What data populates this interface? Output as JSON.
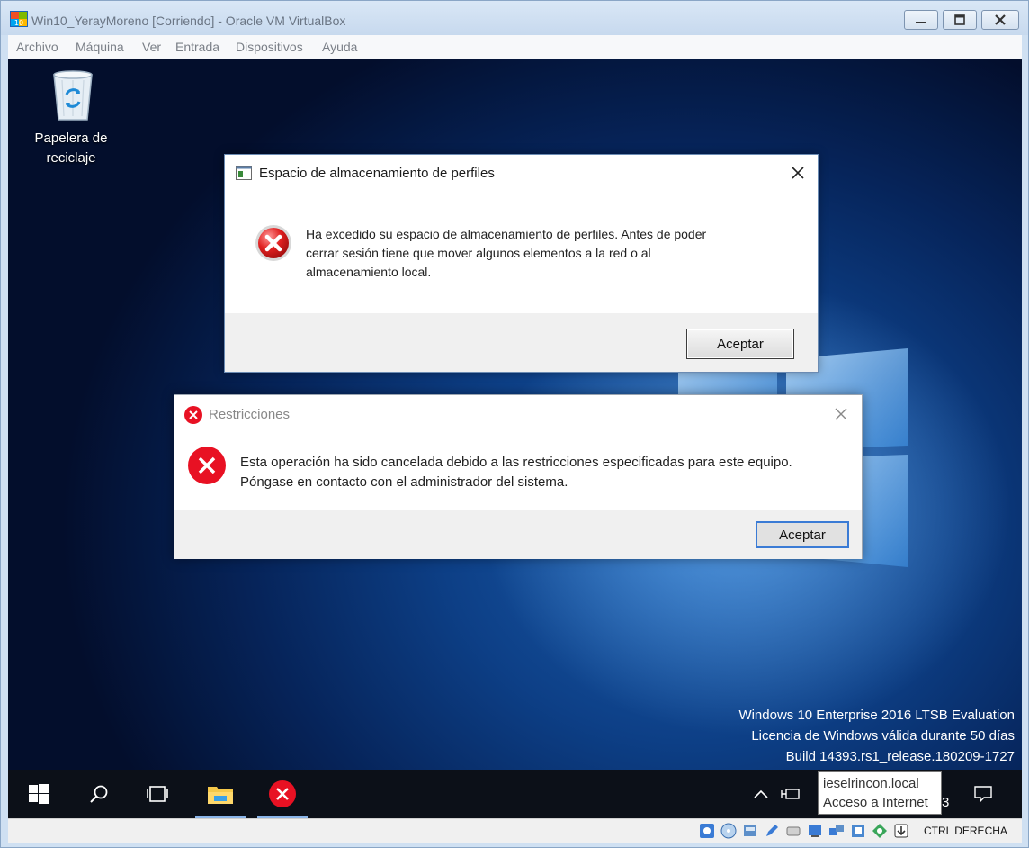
{
  "window": {
    "title": "Win10_YerayMoreno [Corriendo] - Oracle VM VirtualBox"
  },
  "menu": [
    "Archivo",
    "Máquina",
    "Ver",
    "Entrada",
    "Dispositivos",
    "Ayuda"
  ],
  "desktop": {
    "recycle_bin_label_line1": "Papelera de",
    "recycle_bin_label_line2": "reciclaje",
    "watermark": [
      "Windows 10 Enterprise 2016 LTSB Evaluation",
      "Licencia de Windows válida durante 50 días",
      "Build 14393.rs1_release.180209-1727"
    ]
  },
  "dialog_profile": {
    "title": "Espacio de almacenamiento de perfiles",
    "message_line1": "Ha excedido su espacio de almacenamiento de perfiles. Antes de poder",
    "message_line2": "cerrar sesión tiene que mover algunos elementos a la red o al",
    "message_line3": "almacenamiento local.",
    "button": "Aceptar"
  },
  "dialog_restrictions": {
    "title": "Restricciones",
    "message_line1": "Esta operación ha sido cancelada debido a las restricciones especificadas para este equipo.",
    "message_line2": "Póngase en contacto con el administrador del sistema.",
    "button": "Aceptar"
  },
  "tooltip": {
    "line1": "ieselrincon.local",
    "line2": "Acceso a Internet",
    "clipped_char": "3"
  },
  "statusbar": {
    "host_key": "CTRL DERECHA"
  },
  "colors": {
    "error_red": "#e81123",
    "accent_blue": "#3a7bd5",
    "taskbar": "#0c1018"
  }
}
